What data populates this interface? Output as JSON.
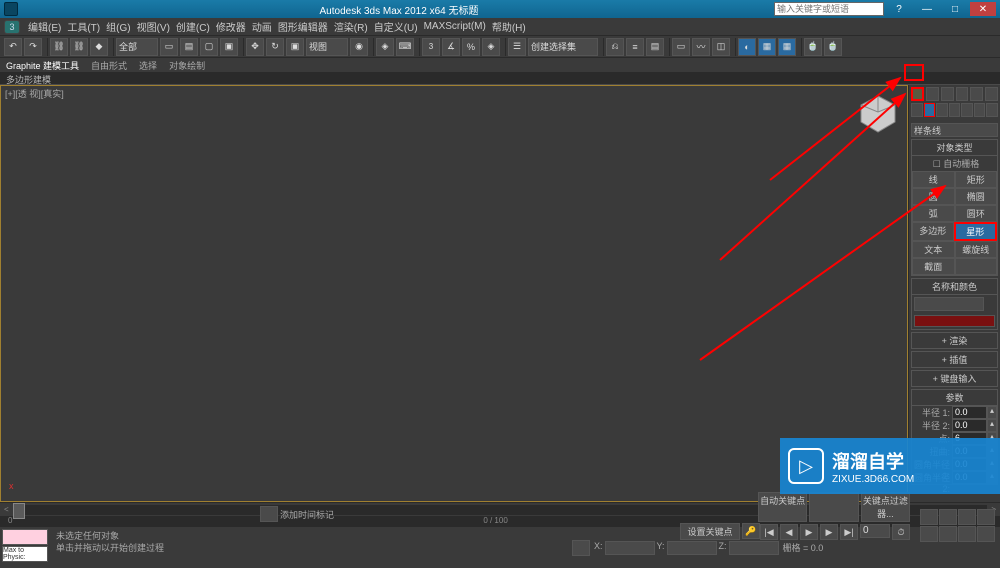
{
  "title": "Autodesk 3ds Max 2012 x64   无标题",
  "search_placeholder": "输入关键字或短语",
  "menus": [
    "编辑(E)",
    "工具(T)",
    "组(G)",
    "视图(V)",
    "创建(C)",
    "修改器",
    "动画",
    "图形编辑器",
    "渲染(R)",
    "自定义(U)",
    "MAXScript(M)",
    "帮助(H)"
  ],
  "toolbar": {
    "dd1": "全部",
    "dd2": "视图",
    "buildsel": "创建选择集"
  },
  "subtabs": [
    "Graphite 建模工具",
    "自由形式",
    "选择",
    "对象绘制"
  ],
  "vplabel": "多边形建模",
  "view_header": "[+][透 视][真实]",
  "right": {
    "dropdown": "样条线",
    "obj_type_title": "对象类型",
    "autogrid": "自动栅格",
    "buttons": [
      [
        "线",
        "矩形"
      ],
      [
        "圆",
        "椭圆"
      ],
      [
        "弧",
        "圆环"
      ],
      [
        "多边形",
        "星形"
      ],
      [
        "文本",
        "螺旋线"
      ],
      [
        "截面",
        ""
      ]
    ],
    "name_color_title": "名称和颜色",
    "roll_render": "渲染",
    "roll_interp": "插值",
    "roll_kbd": "键盘输入",
    "roll_params": "参数",
    "params": [
      {
        "label": "半径 1:",
        "val": "0.0"
      },
      {
        "label": "半径 2:",
        "val": "0.0"
      },
      {
        "label": "点:",
        "val": "6"
      },
      {
        "label": "扭曲:",
        "val": "0.0"
      },
      {
        "label": "圆角半径 1:",
        "val": "0.0"
      },
      {
        "label": "圆角半径 2:",
        "val": "0.0"
      }
    ]
  },
  "timeline": {
    "start": "0",
    "range": "0 / 100",
    "end": "100"
  },
  "status": {
    "mini": "Max to Physic:",
    "sel": "未选定任何对象",
    "hint": "单击并拖动以开始创建过程",
    "tag": "添加时间标记",
    "auto": "自动关键点",
    "setkey": "设置关键点",
    "keyfilter": "关键点过滤器...",
    "x": "",
    "y": "",
    "z": "",
    "grid": "栅格 = 0.0"
  },
  "watermark": {
    "title": "溜溜自学",
    "url": "ZIXUE.3D66.COM"
  }
}
